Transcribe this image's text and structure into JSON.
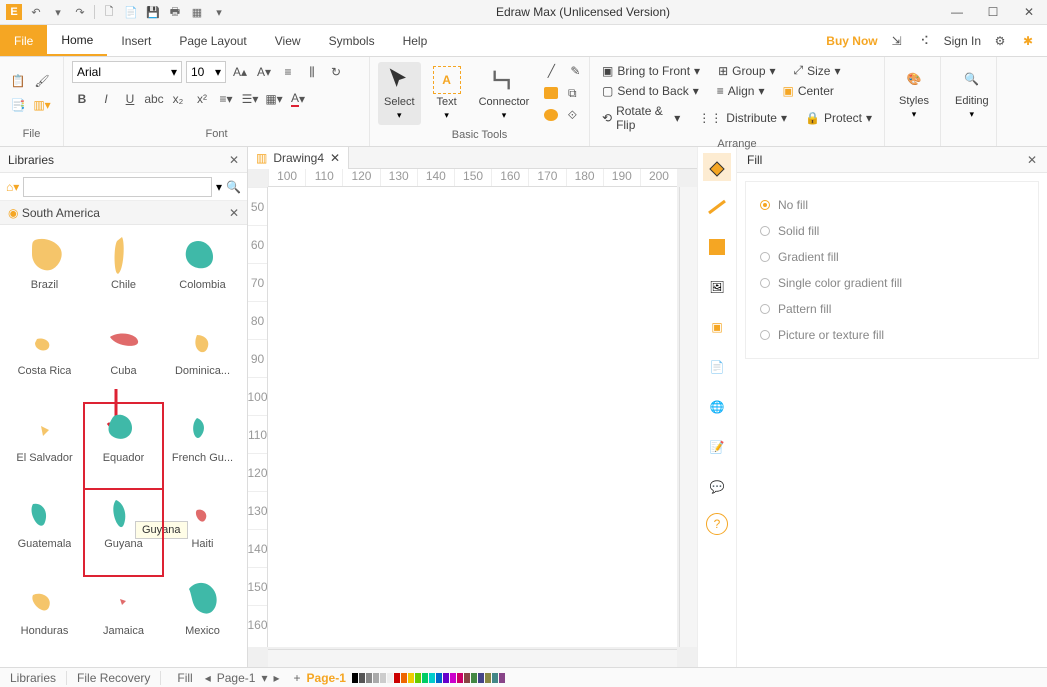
{
  "app": {
    "title": "Edraw Max (Unlicensed Version)"
  },
  "titlebar_icons": [
    "undo",
    "redo",
    "separator",
    "new",
    "open",
    "save",
    "print",
    "template"
  ],
  "menu": {
    "file": "File",
    "tabs": [
      "Home",
      "Insert",
      "Page Layout",
      "View",
      "Symbols",
      "Help"
    ],
    "active": "Home",
    "buy_now": "Buy Now",
    "sign_in": "Sign In"
  },
  "ribbon": {
    "file_group": "File",
    "font": {
      "group": "Font",
      "family": "Arial",
      "size": "10"
    },
    "basic_tools": {
      "group": "Basic Tools",
      "select": "Select",
      "text": "Text",
      "connector": "Connector"
    },
    "arrange": {
      "group": "Arrange",
      "bring_front": "Bring to Front",
      "send_back": "Send to Back",
      "rotate_flip": "Rotate & Flip",
      "group_btn": "Group",
      "align": "Align",
      "distribute": "Distribute",
      "size": "Size",
      "center": "Center",
      "protect": "Protect"
    },
    "styles": "Styles",
    "editing": "Editing"
  },
  "libraries": {
    "title": "Libraries",
    "search_placeholder": "",
    "category": "South America",
    "items": [
      {
        "label": "Brazil",
        "color": "#f5c56a"
      },
      {
        "label": "Chile",
        "color": "#f5c56a"
      },
      {
        "label": "Colombia",
        "color": "#3fb9a8"
      },
      {
        "label": "Costa Rica",
        "color": "#f5c56a"
      },
      {
        "label": "Cuba",
        "color": "#e06b6b"
      },
      {
        "label": "Dominica...",
        "color": "#f5c56a"
      },
      {
        "label": "El Salvador",
        "color": "#f5c56a"
      },
      {
        "label": "Equador",
        "color": "#3fb9a8",
        "highlight": true
      },
      {
        "label": "French Gu...",
        "color": "#3fb9a8"
      },
      {
        "label": "Guatemala",
        "color": "#3fb9a8"
      },
      {
        "label": "Guyana",
        "color": "#3fb9a8",
        "highlight": true
      },
      {
        "label": "Haiti",
        "color": "#e06b6b"
      },
      {
        "label": "Honduras",
        "color": "#f5c56a"
      },
      {
        "label": "Jamaica",
        "color": "#e06b6b"
      },
      {
        "label": "Mexico",
        "color": "#3fb9a8"
      }
    ],
    "tooltip": "Guyana"
  },
  "document": {
    "tab": "Drawing4",
    "h_ruler": [
      "100",
      "110",
      "120",
      "130",
      "140",
      "150",
      "160",
      "170",
      "180",
      "190",
      "200"
    ],
    "v_ruler": [
      "50",
      "60",
      "70",
      "80",
      "90",
      "100",
      "110",
      "120",
      "130",
      "140",
      "150",
      "160"
    ]
  },
  "fill": {
    "title": "Fill",
    "options": [
      "No fill",
      "Solid fill",
      "Gradient fill",
      "Single color gradient fill",
      "Pattern fill",
      "Picture or texture fill"
    ],
    "selected": "No fill"
  },
  "statusbar": {
    "libraries": "Libraries",
    "file_recovery": "File Recovery",
    "fill_label": "Fill",
    "page_dropdown": "Page-1",
    "page_active": "Page-1"
  }
}
